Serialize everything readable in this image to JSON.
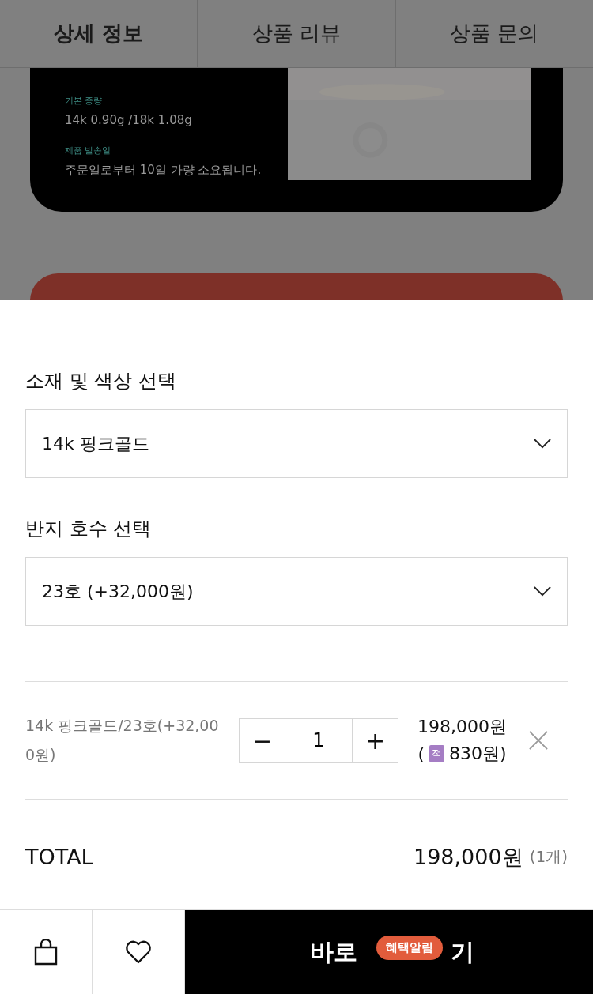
{
  "tabs": [
    {
      "label": "상세 정보",
      "selected": true
    },
    {
      "label": "상품 리뷰",
      "selected": false
    },
    {
      "label": "상품 문의",
      "selected": false
    }
  ],
  "info_card": {
    "fields": [
      {
        "label": "기본 중량",
        "value": "14k 0.90g /18k 1.08g"
      },
      {
        "label": "제품 발송일",
        "value": "주문일로부터 10일 가량 소요됩니다."
      }
    ]
  },
  "options": [
    {
      "label": "소재 및 색상 선택",
      "value": "14k 핑크골드"
    },
    {
      "label": "반지 호수 선택",
      "value": "23호 (+32,000원)"
    }
  ],
  "selected_item": {
    "name": "14k 핑크골드/23호(+32,000원)",
    "quantity": "1",
    "decrease": "−",
    "increase": "+",
    "price": "198,000원",
    "points_open": "(",
    "points_badge": "적",
    "points": "830원)"
  },
  "total": {
    "label": "TOTAL",
    "amount": "198,000원",
    "count": "(1개)"
  },
  "bottom_bar": {
    "buy_label_parts": [
      "바로",
      "기"
    ],
    "badge": "혜택알림"
  }
}
